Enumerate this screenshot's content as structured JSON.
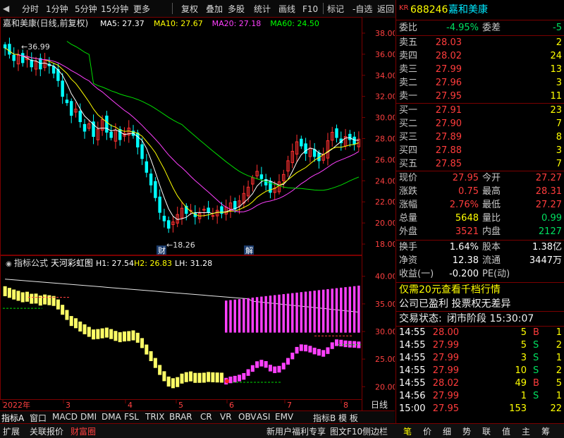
{
  "toolbar": {
    "items": [
      "分时",
      "1分钟",
      "5分钟",
      "15分钟",
      "更多",
      "复权",
      "叠加",
      "多股",
      "统计",
      "画线",
      "F10",
      "标记",
      "-自选",
      "返回"
    ]
  },
  "chart": {
    "title": "嘉和美康(日线,前复权)",
    "ma": [
      {
        "label": "MA5: 27.37",
        "color": "#ffffff"
      },
      {
        "label": "MA10: 27.67",
        "color": "#ffff00"
      },
      {
        "label": "MA20: 27.18",
        "color": "#ff40ff"
      },
      {
        "label": "MA60: 24.50",
        "color": "#00ff00"
      }
    ],
    "high_label": "36.99",
    "low_label": "18.26",
    "marker_cai": "财",
    "marker_jie": "解",
    "y_ticks": [
      "38.00",
      "36.00",
      "34.00",
      "32.00",
      "30.00",
      "28.00",
      "26.00",
      "24.00",
      "22.00",
      "20.00",
      "18.00"
    ],
    "indicator": {
      "name": "指标公式",
      "title": "天河彩虹图",
      "h1": "H1: 27.54",
      "h2": "H2: 26.83",
      "lh": "LH: 31.28",
      "y_ticks": [
        "40.00",
        "35.00",
        "30.00",
        "25.00",
        "20.00"
      ]
    },
    "x_labels": [
      "2022年",
      "3",
      "4",
      "5",
      "6",
      "7",
      "8"
    ],
    "x_unit": "日线"
  },
  "chart_data": {
    "type": "candlestick",
    "ylim": [
      17.2,
      38.6
    ],
    "highest": 36.99,
    "lowest": 18.26,
    "closes": [
      36.6,
      36.0,
      35.4,
      35.9,
      35.2,
      35.7,
      34.8,
      35.3,
      34.6,
      35.4,
      34.9,
      34.2,
      33.5,
      32.0,
      31.4,
      30.2,
      30.8,
      29.6,
      28.7,
      29.4,
      28.2,
      28.9,
      29.8,
      28.6,
      28.1,
      28.8,
      27.9,
      28.5,
      29.0,
      28.3,
      27.2,
      26.1,
      24.8,
      23.6,
      22.4,
      21.0,
      20.2,
      19.5,
      20.1,
      20.8,
      21.4,
      20.9,
      21.2,
      20.6,
      20.9,
      21.3,
      21.0,
      20.7,
      21.2,
      20.9,
      21.5,
      21.9,
      21.3,
      22.1,
      22.8,
      23.4,
      24.3,
      24.9,
      24.2,
      23.6,
      22.9,
      23.3,
      23.9,
      24.6,
      25.9,
      26.8,
      27.7,
      27.3,
      26.6,
      27.1,
      26.3,
      25.9,
      26.5,
      27.8,
      28.6,
      28.1,
      27.6,
      28.2,
      27.9,
      27.5,
      27.95
    ]
  },
  "right": {
    "code": "688246",
    "name": "嘉和美康",
    "kr": "KR",
    "weibi_label": "委比",
    "weibi_value": "-4.95%",
    "weicha_label": "委差",
    "weicha_value": "-5",
    "sells": [
      {
        "label": "卖五",
        "price": "28.03",
        "vol": "2"
      },
      {
        "label": "卖四",
        "price": "28.02",
        "vol": "24"
      },
      {
        "label": "卖三",
        "price": "27.99",
        "vol": "13"
      },
      {
        "label": "卖二",
        "price": "27.96",
        "vol": "3"
      },
      {
        "label": "卖一",
        "price": "27.95",
        "vol": "11"
      }
    ],
    "buys": [
      {
        "label": "买一",
        "price": "27.91",
        "vol": "23"
      },
      {
        "label": "买二",
        "price": "27.90",
        "vol": "7"
      },
      {
        "label": "买三",
        "price": "27.89",
        "vol": "8"
      },
      {
        "label": "买四",
        "price": "27.88",
        "vol": "3"
      },
      {
        "label": "买五",
        "price": "27.85",
        "vol": "7"
      }
    ],
    "quote": [
      {
        "l1": "现价",
        "v1": "27.95",
        "c1": "red",
        "l2": "今开",
        "v2": "27.27",
        "c2": "red"
      },
      {
        "l1": "涨跌",
        "v1": "0.75",
        "c1": "red",
        "l2": "最高",
        "v2": "28.31",
        "c2": "red"
      },
      {
        "l1": "涨幅",
        "v1": "2.76%",
        "c1": "red",
        "l2": "最低",
        "v2": "27.27",
        "c2": "red"
      },
      {
        "l1": "总量",
        "v1": "5648",
        "c1": "yellow",
        "l2": "量比",
        "v2": "0.99",
        "c2": "green"
      },
      {
        "l1": "外盘",
        "v1": "3521",
        "c1": "red",
        "l2": "内盘",
        "v2": "2127",
        "c2": "green"
      }
    ],
    "stats": [
      {
        "l1": "换手",
        "v1": "1.64%",
        "l2": "股本",
        "v2": "1.38亿"
      },
      {
        "l1": "净资",
        "v1": "12.38",
        "l2": "流通",
        "v2": "3447万"
      },
      {
        "l1": "收益(一)",
        "v1": "-0.200",
        "l2": "PE(动)",
        "v2": ""
      }
    ],
    "promo1": "仅需20元查看千档行情",
    "promo2": "公司已盈利 投票权无差异",
    "status_label": "交易状态:",
    "status_value": "闭市阶段 15:30:07",
    "ticks": [
      {
        "t": "14:55",
        "p": "28.00",
        "v": "5",
        "s": "B",
        "n": "1"
      },
      {
        "t": "14:55",
        "p": "27.99",
        "v": "5",
        "s": "S",
        "n": "2"
      },
      {
        "t": "14:55",
        "p": "27.99",
        "v": "3",
        "s": "S",
        "n": "1"
      },
      {
        "t": "14:55",
        "p": "27.99",
        "v": "10",
        "s": "S",
        "n": "2"
      },
      {
        "t": "14:55",
        "p": "28.02",
        "v": "49",
        "s": "B",
        "n": "5"
      },
      {
        "t": "14:56",
        "p": "27.99",
        "v": "1",
        "s": "S",
        "n": "1"
      },
      {
        "t": "15:00",
        "p": "27.95",
        "v": "153",
        "s": "",
        "n": "22"
      }
    ]
  },
  "bottom1": [
    "指标A",
    "窗口",
    "MACD",
    "DMI",
    "DMA",
    "FSL",
    "TRIX",
    "BRAR",
    "CR",
    "VR",
    "OBV",
    "ASI",
    "EMV",
    "指标B",
    "模 板"
  ],
  "bottom2_left": [
    "扩展",
    "关联报价",
    "财富圈"
  ],
  "bottom2_right": [
    "新用户福利专享",
    "图文F10",
    "侧边栏"
  ],
  "bottom2_tabs": [
    "笔",
    "价",
    "细",
    "势",
    "联",
    "值",
    "主",
    "筹"
  ]
}
